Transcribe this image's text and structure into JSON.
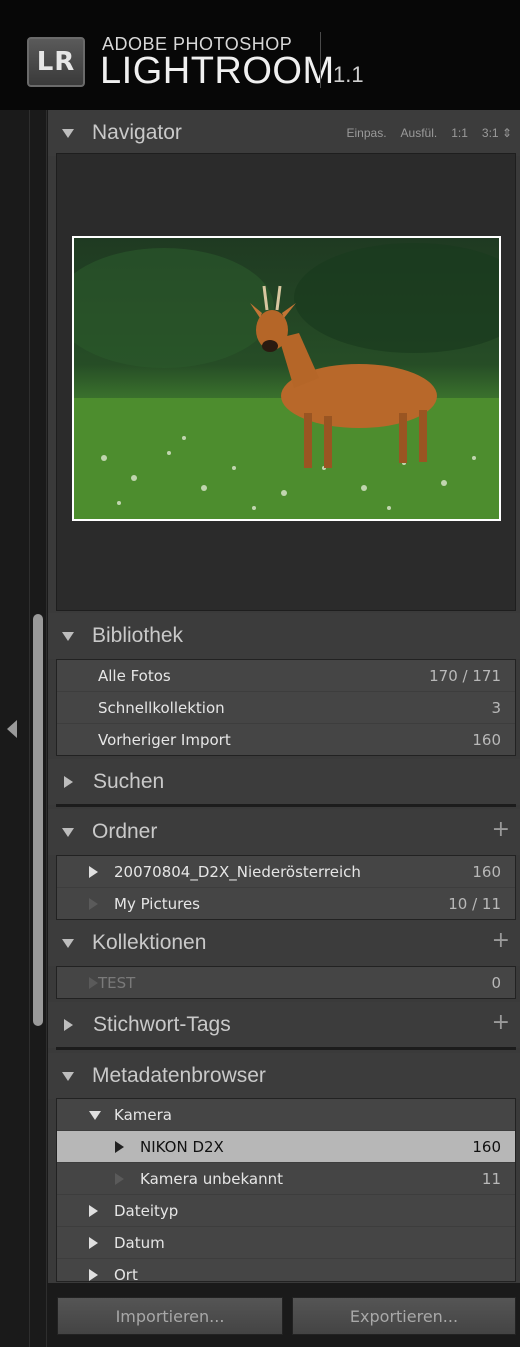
{
  "header": {
    "logo_text": "LR",
    "brand_top": "ADOBE PHOTOSHOP",
    "brand_main": "LIGHTROOM",
    "version": "1.1"
  },
  "navigator": {
    "title": "Navigator",
    "options": [
      "Einpas.",
      "Ausfül.",
      "1:1",
      "3:1 ⇕"
    ]
  },
  "bibliothek": {
    "title": "Bibliothek",
    "rows": [
      {
        "label": "Alle Fotos",
        "count": "170 / 171"
      },
      {
        "label": "Schnellkollektion",
        "count": "3"
      },
      {
        "label": "Vorheriger Import",
        "count": "160"
      }
    ]
  },
  "suchen": {
    "title": "Suchen"
  },
  "ordner": {
    "title": "Ordner",
    "add": "+",
    "rows": [
      {
        "label": "20070804_D2X_Niederösterreich",
        "count": "160"
      },
      {
        "label": "My Pictures",
        "count": "10 / 11"
      }
    ]
  },
  "kollektionen": {
    "title": "Kollektionen",
    "add": "+",
    "rows": [
      {
        "label": "TEST",
        "count": "0"
      }
    ]
  },
  "stichwort": {
    "title": "Stichwort-Tags",
    "add": "+"
  },
  "metadaten": {
    "title": "Metadatenbrowser",
    "rows": [
      {
        "label": "Kamera",
        "count": ""
      },
      {
        "label": "NIKON D2X",
        "count": "160"
      },
      {
        "label": "Kamera unbekannt",
        "count": "11"
      },
      {
        "label": "Dateityp",
        "count": ""
      },
      {
        "label": "Datum",
        "count": ""
      },
      {
        "label": "Ort",
        "count": ""
      }
    ]
  },
  "buttons": {
    "import": "Importieren...",
    "export": "Exportieren..."
  }
}
